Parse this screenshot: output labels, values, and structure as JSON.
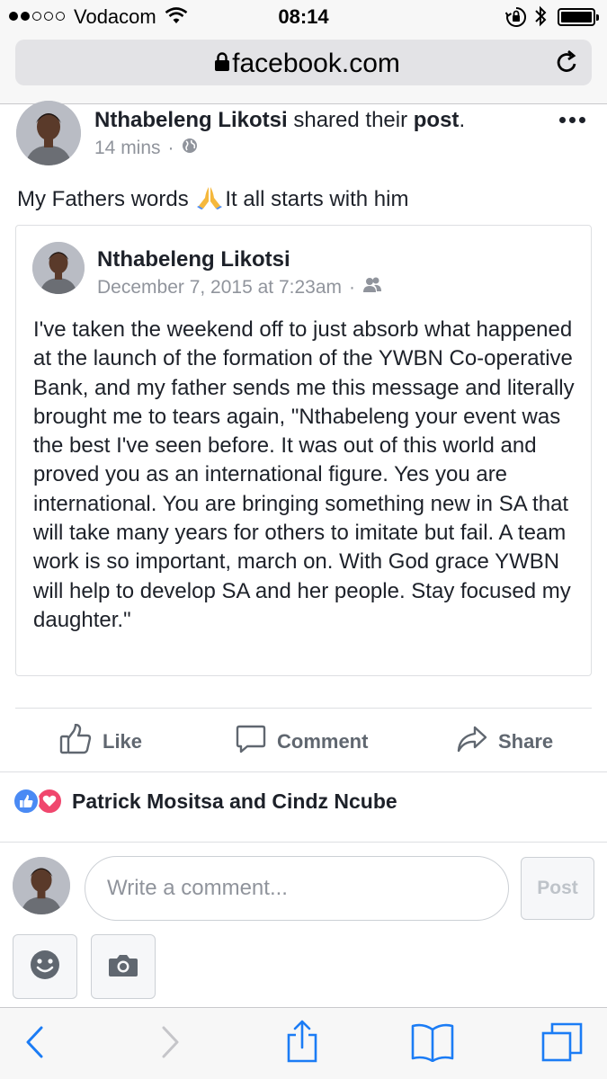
{
  "status_bar": {
    "carrier": "Vodacom",
    "time": "08:14"
  },
  "browser": {
    "url": "facebook.com"
  },
  "post": {
    "author": "Nthabeleng Likotsi",
    "action_text": " shared their ",
    "object": "post",
    "suffix": ".",
    "time": "14 mins",
    "privacy": "globe-icon",
    "text_before": "My Fathers words ",
    "text_after": "It all starts with him"
  },
  "shared": {
    "author": "Nthabeleng Likotsi",
    "date": "December 7, 2015 at 7:23am",
    "privacy": "friends-icon",
    "body": "I've taken the weekend off to just absorb what happened at the launch of the formation of the YWBN Co-operative Bank, and my father sends me this message and literally brought me to tears again, \"Nthabeleng your event was the best I've seen before. It was out of this world and proved you as an international figure. Yes you are international. You are bringing something new in SA that will take many years for others to imitate but fail. A team work is so important, march on. With God grace YWBN will help to develop SA and her people. Stay focused my daughter.\""
  },
  "actions": {
    "like": "Like",
    "comment": "Comment",
    "share": "Share"
  },
  "reactions": {
    "names": "Patrick Mositsa and Cindz Ncube"
  },
  "composer": {
    "placeholder": "Write a comment...",
    "post_label": "Post"
  },
  "colors": {
    "brand_blue": "#4a8af4",
    "love_red": "#f0476e",
    "ios_blue": "#1b7cf5",
    "meta_gray": "#90949c"
  }
}
